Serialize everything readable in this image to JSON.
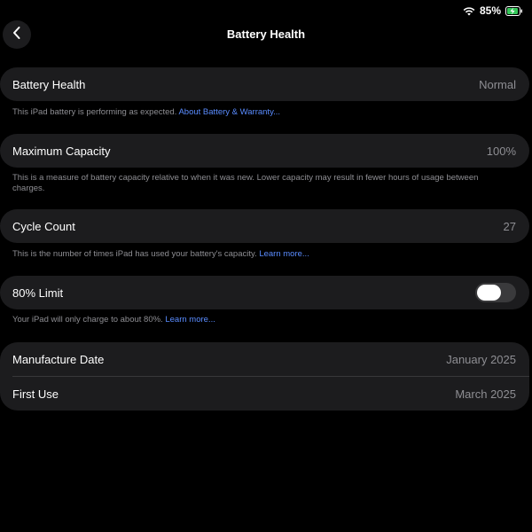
{
  "status": {
    "battery_percent": "85%",
    "charging": true,
    "wifi": true
  },
  "header": {
    "title": "Battery Health",
    "back_icon": "chevron-left-icon"
  },
  "battery_health": {
    "label": "Battery Health",
    "value": "Normal",
    "description": "This iPad battery is performing as expected.",
    "link": "About Battery & Warranty..."
  },
  "maximum_capacity": {
    "label": "Maximum Capacity",
    "value": "100%",
    "description": "This is a measure of battery capacity relative to when it was new. Lower capacity may result in fewer hours of usage between charges."
  },
  "cycle_count": {
    "label": "Cycle Count",
    "value": "27",
    "description": "This is the number of times iPad has used your battery's capacity.",
    "link": "Learn more..."
  },
  "limit": {
    "label": "80% Limit",
    "enabled": false,
    "description": "Your iPad will only charge to about 80%.",
    "link": "Learn more..."
  },
  "dates": {
    "manufacture_label": "Manufacture Date",
    "manufacture_value": "January 2025",
    "first_use_label": "First Use",
    "first_use_value": "March 2025"
  },
  "colors": {
    "background": "#000000",
    "card": "#1c1c1e",
    "link": "#5a8cff",
    "secondary_text": "#8e8e93"
  }
}
